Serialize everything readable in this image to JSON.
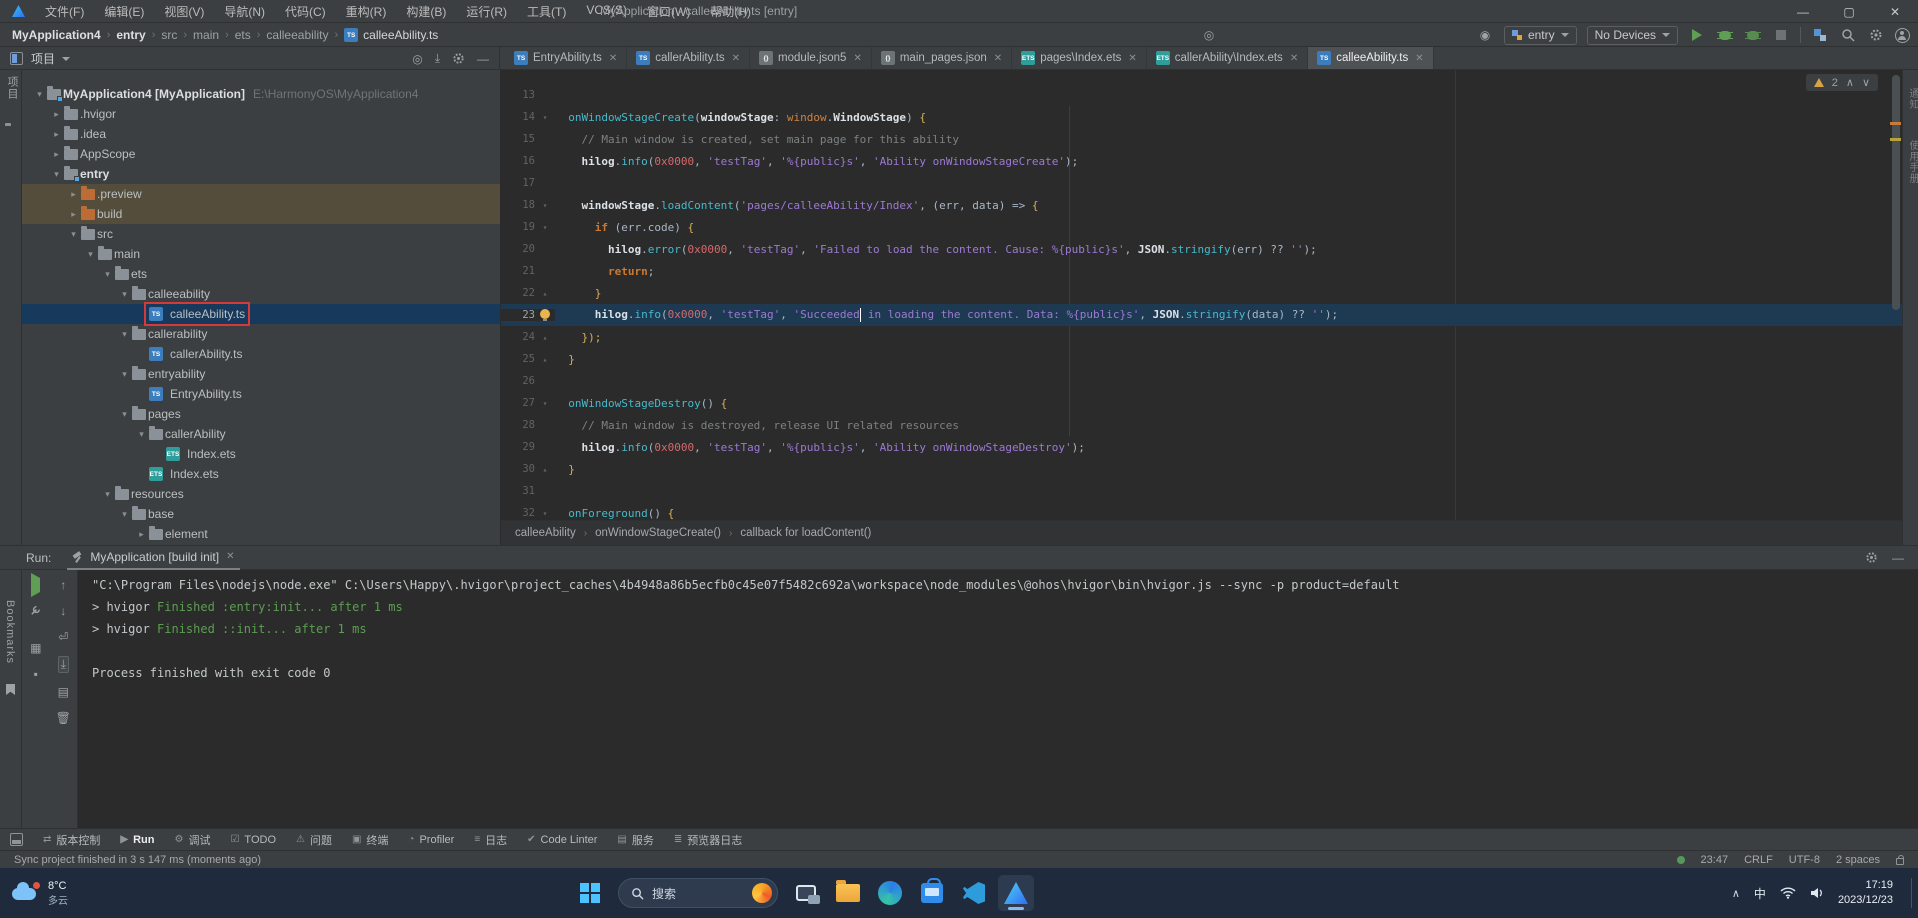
{
  "title_bar": {
    "title": "MyApplication - calleeAbility.ts [entry]",
    "menus": [
      "文件(F)",
      "编辑(E)",
      "视图(V)",
      "导航(N)",
      "代码(C)",
      "重构(R)",
      "构建(B)",
      "运行(R)",
      "工具(T)",
      "VCS(S)",
      "窗口(W)",
      "帮助(H)"
    ],
    "window_buttons": [
      "—",
      "□",
      "✕"
    ]
  },
  "toolbar": {
    "breadcrumbs": [
      {
        "label": "MyApplication4",
        "bold": true
      },
      {
        "label": "entry",
        "bold": true
      },
      {
        "label": "src"
      },
      {
        "label": "main"
      },
      {
        "label": "ets"
      },
      {
        "label": "calleeability"
      },
      {
        "label": "calleeAbility.ts",
        "file": "ts"
      }
    ],
    "run_config": "entry",
    "device": "No Devices"
  },
  "project_panel": {
    "header_label": "项目",
    "tree": [
      {
        "depth": 0,
        "chev": "v",
        "icon": "module",
        "label": "MyApplication4 [MyApplication]",
        "bold": true,
        "path": "E:\\HarmonyOS\\MyApplication4"
      },
      {
        "depth": 1,
        "chev": ">",
        "icon": "folder",
        "label": ".hvigor"
      },
      {
        "depth": 1,
        "chev": ">",
        "icon": "folder",
        "label": ".idea"
      },
      {
        "depth": 1,
        "chev": ">",
        "icon": "folder",
        "label": "AppScope"
      },
      {
        "depth": 1,
        "chev": "v",
        "icon": "module",
        "label": "entry",
        "bold": true
      },
      {
        "depth": 2,
        "chev": ">",
        "icon": "folder-o",
        "label": ".preview",
        "olive": true
      },
      {
        "depth": 2,
        "chev": ">",
        "icon": "folder-o",
        "label": "build",
        "olive": true
      },
      {
        "depth": 2,
        "chev": "v",
        "icon": "folder",
        "label": "src"
      },
      {
        "depth": 3,
        "chev": "v",
        "icon": "folder",
        "label": "main"
      },
      {
        "depth": 4,
        "chev": "v",
        "icon": "folder",
        "label": "ets"
      },
      {
        "depth": 5,
        "chev": "v",
        "icon": "folder",
        "label": "calleeability"
      },
      {
        "depth": 6,
        "chev": "",
        "icon": "ts",
        "label": "calleeAbility.ts",
        "sel": true,
        "box": true
      },
      {
        "depth": 5,
        "chev": "v",
        "icon": "folder",
        "label": "callerability"
      },
      {
        "depth": 6,
        "chev": "",
        "icon": "ts",
        "label": "callerAbility.ts"
      },
      {
        "depth": 5,
        "chev": "v",
        "icon": "folder",
        "label": "entryability"
      },
      {
        "depth": 6,
        "chev": "",
        "icon": "ts",
        "label": "EntryAbility.ts"
      },
      {
        "depth": 5,
        "chev": "v",
        "icon": "folder",
        "label": "pages"
      },
      {
        "depth": 6,
        "chev": "v",
        "icon": "folder",
        "label": "callerAbility"
      },
      {
        "depth": 7,
        "chev": "",
        "icon": "ets",
        "label": "Index.ets"
      },
      {
        "depth": 6,
        "chev": "",
        "icon": "ets",
        "label": "Index.ets"
      },
      {
        "depth": 4,
        "chev": "v",
        "icon": "folder",
        "label": "resources"
      },
      {
        "depth": 5,
        "chev": "v",
        "icon": "folder",
        "label": "base"
      },
      {
        "depth": 6,
        "chev": ">",
        "icon": "folder",
        "label": "element"
      }
    ]
  },
  "tabs": [
    {
      "label": "EntryAbility.ts",
      "icon": "ts"
    },
    {
      "label": "callerAbility.ts",
      "icon": "ts"
    },
    {
      "label": "module.json5",
      "icon": "json"
    },
    {
      "label": "main_pages.json",
      "icon": "json"
    },
    {
      "label": "pages\\Index.ets",
      "icon": "ets"
    },
    {
      "label": "callerAbility\\Index.ets",
      "icon": "ets"
    },
    {
      "label": "calleeAbility.ts",
      "icon": "ts",
      "active": true
    }
  ],
  "editor": {
    "inspection_warnings": "2",
    "breadcrumb": [
      "calleeAbility",
      "onWindowStageCreate()",
      "callback for loadContent()"
    ],
    "lines": [
      {
        "n": 13,
        "fold": "",
        "tokens": []
      },
      {
        "n": 14,
        "fold": "v",
        "tokens": [
          [
            "p",
            "  "
          ],
          [
            "m",
            "onWindowStageCreate"
          ],
          [
            "p",
            "("
          ],
          [
            "b",
            "windowStage"
          ],
          [
            "p",
            ": "
          ],
          [
            "ns",
            "window"
          ],
          [
            "p",
            "."
          ],
          [
            "b",
            "WindowStage"
          ],
          [
            "p",
            ") "
          ],
          [
            "br",
            "{"
          ]
        ]
      },
      {
        "n": 15,
        "fold": "",
        "tokens": [
          [
            "p",
            "    "
          ],
          [
            "c",
            "// Main window is created, set main page for this ability"
          ]
        ]
      },
      {
        "n": 16,
        "fold": "",
        "tokens": [
          [
            "p",
            "    "
          ],
          [
            "b",
            "hilog"
          ],
          [
            "p",
            "."
          ],
          [
            "m",
            "info"
          ],
          [
            "p",
            "("
          ],
          [
            "n",
            "0x0000"
          ],
          [
            "p",
            ", "
          ],
          [
            "s",
            "'testTag'"
          ],
          [
            "p",
            ", "
          ],
          [
            "s",
            "'%{public}s'"
          ],
          [
            "p",
            ", "
          ],
          [
            "s",
            "'Ability onWindowStageCreate'"
          ],
          [
            "p",
            ");"
          ]
        ]
      },
      {
        "n": 17,
        "fold": "",
        "tokens": []
      },
      {
        "n": 18,
        "fold": "v",
        "tokens": [
          [
            "p",
            "    "
          ],
          [
            "b",
            "windowStage"
          ],
          [
            "p",
            "."
          ],
          [
            "m",
            "loadContent"
          ],
          [
            "p",
            "("
          ],
          [
            "s",
            "'pages/calleeAbility/Index'"
          ],
          [
            "p",
            ", (err, data) => "
          ],
          [
            "br",
            "{"
          ]
        ]
      },
      {
        "n": 19,
        "fold": "v",
        "tokens": [
          [
            "p",
            "      "
          ],
          [
            "k",
            "if"
          ],
          [
            "p",
            " (err.code) "
          ],
          [
            "br",
            "{"
          ]
        ]
      },
      {
        "n": 20,
        "fold": "",
        "tokens": [
          [
            "p",
            "        "
          ],
          [
            "b",
            "hilog"
          ],
          [
            "p",
            "."
          ],
          [
            "m",
            "error"
          ],
          [
            "p",
            "("
          ],
          [
            "n",
            "0x0000"
          ],
          [
            "p",
            ", "
          ],
          [
            "s",
            "'testTag'"
          ],
          [
            "p",
            ", "
          ],
          [
            "s",
            "'Failed to load the content. Cause: %{public}s'"
          ],
          [
            "p",
            ", "
          ],
          [
            "b",
            "JSON"
          ],
          [
            "p",
            "."
          ],
          [
            "m",
            "stringify"
          ],
          [
            "p",
            "(err) ?? "
          ],
          [
            "s",
            "''"
          ],
          [
            "p",
            ");"
          ]
        ]
      },
      {
        "n": 21,
        "fold": "",
        "tokens": [
          [
            "p",
            "        "
          ],
          [
            "k",
            "return"
          ],
          [
            "p",
            ";"
          ]
        ]
      },
      {
        "n": 22,
        "fold": "^",
        "tokens": [
          [
            "p",
            "      "
          ],
          [
            "br",
            "}"
          ]
        ]
      },
      {
        "n": 23,
        "fold": "bulb",
        "active": true,
        "tokens": [
          [
            "p",
            "      "
          ],
          [
            "b",
            "hilog"
          ],
          [
            "p",
            "."
          ],
          [
            "m",
            "info"
          ],
          [
            "p",
            "("
          ],
          [
            "n",
            "0x0000"
          ],
          [
            "p",
            ", "
          ],
          [
            "s",
            "'testTag'"
          ],
          [
            "p",
            ", "
          ],
          [
            "s",
            "'Succeeded"
          ],
          [
            "caret",
            ""
          ],
          [
            "s",
            " in loading the content. Data: %{public}s'"
          ],
          [
            "p",
            ", "
          ],
          [
            "b",
            "JSON"
          ],
          [
            "p",
            "."
          ],
          [
            "m",
            "stringify"
          ],
          [
            "p",
            "(data) ?? "
          ],
          [
            "s",
            "''"
          ],
          [
            "p",
            ");"
          ]
        ]
      },
      {
        "n": 24,
        "fold": "^",
        "tokens": [
          [
            "p",
            "    "
          ],
          [
            "br",
            "});"
          ]
        ]
      },
      {
        "n": 25,
        "fold": "^",
        "tokens": [
          [
            "p",
            "  "
          ],
          [
            "br",
            "}"
          ]
        ]
      },
      {
        "n": 26,
        "fold": "",
        "tokens": []
      },
      {
        "n": 27,
        "fold": "v",
        "tokens": [
          [
            "p",
            "  "
          ],
          [
            "m",
            "onWindowStageDestroy"
          ],
          [
            "p",
            "() "
          ],
          [
            "br",
            "{"
          ]
        ]
      },
      {
        "n": 28,
        "fold": "",
        "tokens": [
          [
            "p",
            "    "
          ],
          [
            "c",
            "// Main window is destroyed, release UI related resources"
          ]
        ]
      },
      {
        "n": 29,
        "fold": "",
        "tokens": [
          [
            "p",
            "    "
          ],
          [
            "b",
            "hilog"
          ],
          [
            "p",
            "."
          ],
          [
            "m",
            "info"
          ],
          [
            "p",
            "("
          ],
          [
            "n",
            "0x0000"
          ],
          [
            "p",
            ", "
          ],
          [
            "s",
            "'testTag'"
          ],
          [
            "p",
            ", "
          ],
          [
            "s",
            "'%{public}s'"
          ],
          [
            "p",
            ", "
          ],
          [
            "s",
            "'Ability onWindowStageDestroy'"
          ],
          [
            "p",
            ");"
          ]
        ]
      },
      {
        "n": 30,
        "fold": "^",
        "tokens": [
          [
            "p",
            "  "
          ],
          [
            "br",
            "}"
          ]
        ]
      },
      {
        "n": 31,
        "fold": "",
        "tokens": []
      },
      {
        "n": 32,
        "fold": "v",
        "tokens": [
          [
            "p",
            "  "
          ],
          [
            "m",
            "onForeground"
          ],
          [
            "p",
            "() "
          ],
          [
            "br",
            "{"
          ]
        ]
      }
    ]
  },
  "run_panel": {
    "label": "Run:",
    "tab": "MyApplication [build init]",
    "console": [
      [
        [
          "c",
          "\"C:\\Program Files\\nodejs\\node.exe\" C:\\Users\\Happy\\.hvigor\\project_caches\\4b4948a86b5ecfb0c45e07f5482c692a\\workspace\\node_modules\\@ohos\\hvigor\\bin\\hvigor.js --sync -p product=default"
        ]
      ],
      [
        [
          "c",
          "> hvigor "
        ],
        [
          "g",
          "Finished :entry:init... after 1 ms"
        ]
      ],
      [
        [
          "c",
          "> hvigor "
        ],
        [
          "g",
          "Finished ::init... after 1 ms"
        ]
      ],
      [],
      [
        [
          "c",
          "Process finished with exit code 0"
        ]
      ]
    ]
  },
  "bottom_bar": {
    "items": [
      {
        "icon": "⇄",
        "label": "版本控制"
      },
      {
        "icon": "▶",
        "label": "Run",
        "active": true
      },
      {
        "icon": "⚙",
        "label": "调试"
      },
      {
        "icon": "☑",
        "label": "TODO"
      },
      {
        "icon": "⚠",
        "label": "问题"
      },
      {
        "icon": "▣",
        "label": "终端"
      },
      {
        "icon": "◔",
        "label": "Profiler"
      },
      {
        "icon": "≡",
        "label": "日志"
      },
      {
        "icon": "✔",
        "label": "Code Linter"
      },
      {
        "icon": "▤",
        "label": "服务"
      },
      {
        "icon": "≣",
        "label": "预览器日志"
      }
    ]
  },
  "status_bar": {
    "sync": "Sync project finished in 3 s 147 ms (moments ago)",
    "clock": "23:47",
    "line_ending": "CRLF",
    "encoding": "UTF-8",
    "indent": "2 spaces"
  },
  "stripes": {
    "left_top": "项目",
    "left_bottom": "Bookmarks",
    "right_1": "通知",
    "right_2": "使用手册"
  },
  "taskbar": {
    "weather_temp": "8°C",
    "weather_cond": "多云",
    "search_placeholder": "搜索",
    "apps": [
      "task-view",
      "file-explorer",
      "edge",
      "store",
      "vscode",
      "deveco-studio"
    ],
    "active_app": "deveco-studio",
    "tray_chevron": "∧",
    "tray_ime": "中",
    "time": "17:19",
    "date": "2023/12/23"
  }
}
